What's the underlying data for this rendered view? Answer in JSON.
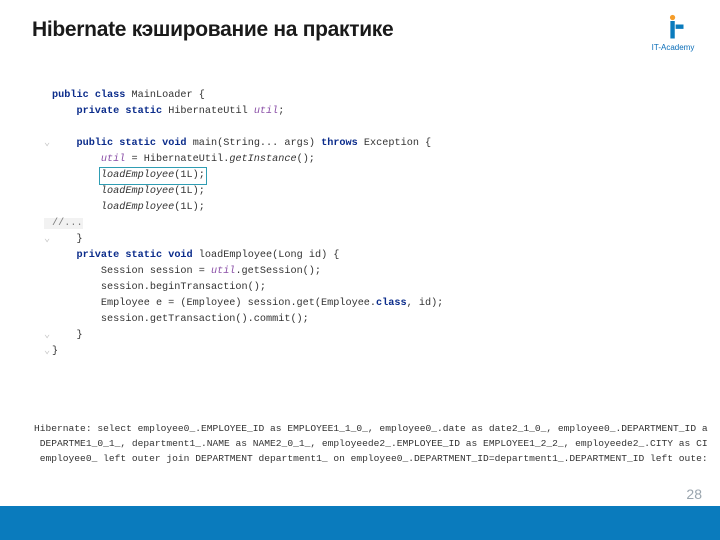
{
  "title": "Hibernate кэширование на практике",
  "logo_text": "IT-Academy",
  "code": {
    "kw_public1": "public",
    "kw_class": "class",
    "cls_main": "MainLoader {",
    "kw_private1": "private",
    "kw_static1": "static",
    "type_hutil": "HibernateUtil",
    "field_util": "util",
    "semi": ";",
    "kw_public2": "public",
    "kw_static2": "static",
    "kw_void1": "void",
    "sig_main": "main(String... args)",
    "kw_throws": "throws",
    "exc": "Exception {",
    "line_getinst_a": "util",
    "line_getinst_b": " = HibernateUtil.",
    "line_getinst_c": "getInstance",
    "line_getinst_d": "();",
    "call_load": "loadEmployee",
    "arg_1L": "(1L);",
    "comment_ell": "//...",
    "brace_close": "}",
    "kw_private2": "private",
    "kw_static3": "static",
    "kw_void2": "void",
    "sig_loadEmp": "loadEmployee(Long id) {",
    "l_sess": "Session session = ",
    "l_sess_f": "util",
    "l_sess_g": ".getSession();",
    "l_begin": "session.beginTransaction();",
    "l_get_a": "Employee e = (Employee) session.get(Employee.",
    "l_get_b": "class",
    "l_get_c": ", id);",
    "l_commit": "session.getTransaction().commit();"
  },
  "sql": {
    "l1": "Hibernate: select employee0_.EMPLOYEE_ID as EMPLOYEE1_1_0_, employee0_.date as date2_1_0_, employee0_.DEPARTMENT_ID a",
    "l2": " DEPARTME1_0_1_, department1_.NAME as NAME2_0_1_, employeede2_.EMPLOYEE_ID as EMPLOYEE1_2_2_, employeede2_.CITY as CI",
    "l3": " employee0_ left outer join DEPARTMENT department1_ on employee0_.DEPARTMENT_ID=department1_.DEPARTMENT_ID left oute:"
  },
  "page": "28"
}
